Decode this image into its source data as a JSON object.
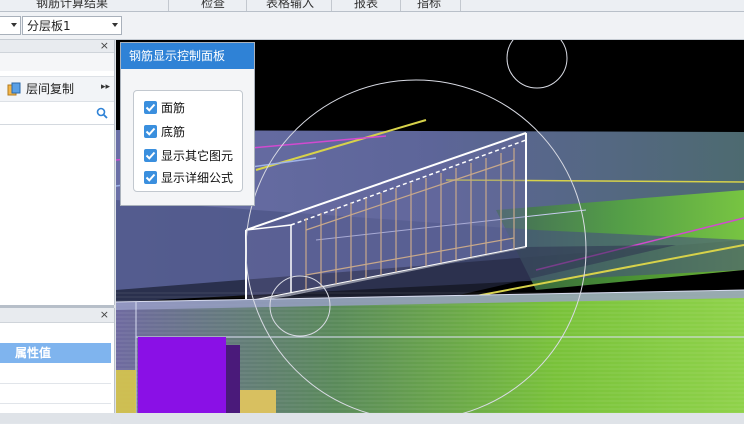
{
  "menubar": {
    "items": [
      "钢筋计算结果",
      "检查",
      "表格输入",
      "报表",
      "指标"
    ]
  },
  "toolbar": {
    "floor_combo_value": "",
    "layer_combo_value": "分层板1"
  },
  "left_panel": {
    "copy_label": "层间复制",
    "search_value": ""
  },
  "property_panel": {
    "column_header": "属性值"
  },
  "control_panel": {
    "title": "钢筋显示控制面板",
    "options": [
      {
        "label": "面筋",
        "checked": true
      },
      {
        "label": "底筋",
        "checked": true
      },
      {
        "label": "显示其它图元",
        "checked": true
      },
      {
        "label": "显示详细公式",
        "checked": true
      }
    ]
  },
  "colors": {
    "accent": "#2f82d6",
    "checkbox": "#3a8fde",
    "header_blue": "#7fb4ee"
  }
}
